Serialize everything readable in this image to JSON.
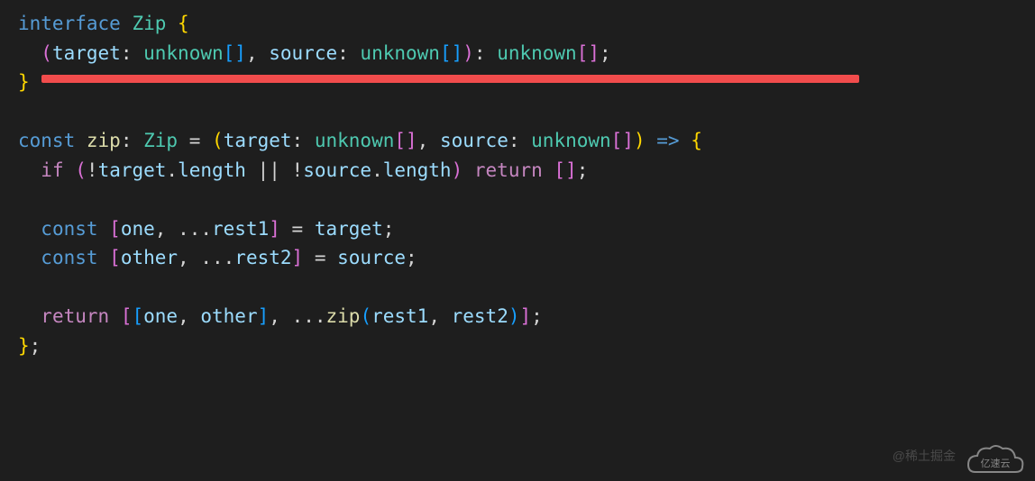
{
  "code": {
    "line1": {
      "kw": "interface",
      "name": "Zip",
      "brace": "{"
    },
    "line2": {
      "lparen": "(",
      "p1": "target",
      "colon1": ":",
      "t1a": "unknown",
      "br1": "[]",
      "comma": ",",
      "p2": "source",
      "colon2": ":",
      "t2a": "unknown",
      "br2": "[]",
      "rparen": ")",
      "colon3": ":",
      "ret": "unknown",
      "br3": "[]",
      "semi": ";"
    },
    "line3": {
      "brace": "}"
    },
    "line5": {
      "kw": "const",
      "name": "zip",
      "colon": ":",
      "type": "Zip",
      "eq": "=",
      "lparen": "(",
      "p1": "target",
      "colon1": ":",
      "t1": "unknown",
      "br1": "[]",
      "comma": ",",
      "p2": "source",
      "colon2": ":",
      "t2": "unknown",
      "br2": "[]",
      "rparen": ")",
      "arrow": "=>",
      "brace": "{"
    },
    "line6": {
      "kw": "if",
      "lparen": "(",
      "not1": "!",
      "v1": "target",
      "dot1": ".",
      "prop1": "length",
      "or": "||",
      "not2": "!",
      "v2": "source",
      "dot2": ".",
      "prop2": "length",
      "rparen": ")",
      "ret": "return",
      "lbrk": "[",
      "rbrk": "]",
      "semi": ";"
    },
    "line8": {
      "kw": "const",
      "lbrk": "[",
      "v1": "one",
      "comma": ",",
      "spread": "...",
      "v2": "rest1",
      "rbrk": "]",
      "eq": "=",
      "src": "target",
      "semi": ";"
    },
    "line9": {
      "kw": "const",
      "lbrk": "[",
      "v1": "other",
      "comma": ",",
      "spread": "...",
      "v2": "rest2",
      "rbrk": "]",
      "eq": "=",
      "src": "source",
      "semi": ";"
    },
    "line11": {
      "kw": "return",
      "l1": "[",
      "l2": "[",
      "v1": "one",
      "c1": ",",
      "v2": "other",
      "r2": "]",
      "c2": ",",
      "spread": "...",
      "fn": "zip",
      "lp": "(",
      "a1": "rest1",
      "c3": ",",
      "a2": "rest2",
      "rp": ")",
      "r1": "]",
      "semi": ";"
    },
    "line12": {
      "brace": "}",
      "semi": ";"
    }
  },
  "watermark": "@稀土掘金",
  "logo_text": "亿速云"
}
